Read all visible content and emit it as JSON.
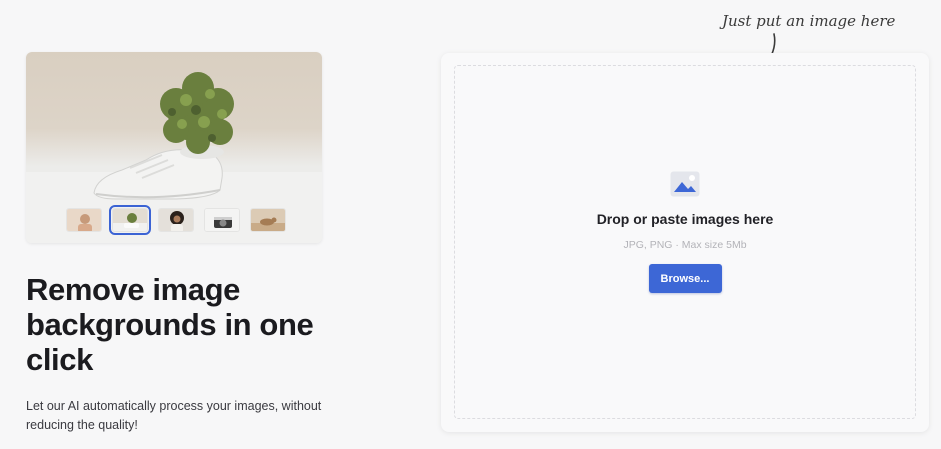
{
  "hero": {
    "headline": "Remove image backgrounds in one click",
    "description": "Let our AI automatically process your images, without reducing the quality!"
  },
  "preview": {
    "thumbnails": [
      {
        "name": "woman-portrait",
        "selected": false
      },
      {
        "name": "plant-shoe",
        "selected": true
      },
      {
        "name": "curly-hair-woman",
        "selected": false
      },
      {
        "name": "camera",
        "selected": false
      },
      {
        "name": "cat-on-furniture",
        "selected": false
      }
    ]
  },
  "annotation": {
    "hint": "Just put an image here"
  },
  "dropzone": {
    "title": "Drop or paste images here",
    "meta": "JPG, PNG · Max size 5Mb",
    "browse_label": "Browse...",
    "icon": "image-icon"
  },
  "colors": {
    "accent": "#3d67d6",
    "background": "#f7f7f8",
    "text": "#1b1b1f"
  }
}
